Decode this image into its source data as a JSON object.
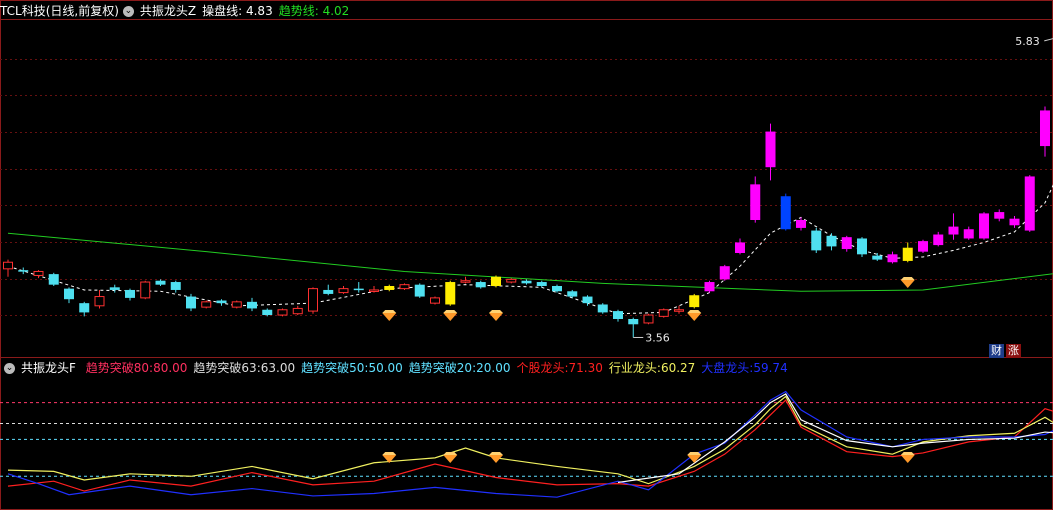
{
  "colors": {
    "up": "#ff00ff",
    "down": "#4fe0f0",
    "signal_bar": "#ffee00",
    "breakout_bar": "#0044ff",
    "ma_line": "#22cc22",
    "trend_line": "#ffffff",
    "diamond": "#ff9a2a",
    "line_red": "#ff2020",
    "line_yellow": "#f0f060",
    "line_blue": "#2030ff",
    "line_white": "#ffffff"
  },
  "header_main": {
    "stock": "TCL科技(日线,前复权)",
    "indicator": "共振龙头Z",
    "op_label": "操盘线:",
    "op_value": "4.83",
    "trend_label": "趋势线:",
    "trend_value": "4.02"
  },
  "header_sub": {
    "indicator": "共振龙头F",
    "items": [
      {
        "label": "趋势突破80:",
        "value": "80.00",
        "color": "#ff3060"
      },
      {
        "label": "趋势突破63:",
        "value": "63.00",
        "color": "#dddddd"
      },
      {
        "label": "趋势突破50:",
        "value": "50.00",
        "color": "#60e0ff"
      },
      {
        "label": "趋势突破20:",
        "value": "20.00",
        "color": "#60e0ff"
      },
      {
        "label": "个股龙头:",
        "value": "71.30",
        "color": "#ff2020"
      },
      {
        "label": "行业龙头:",
        "value": "60.27",
        "color": "#f0f060"
      },
      {
        "label": "大盘龙头:",
        "value": "59.74",
        "color": "#2030ff"
      }
    ]
  },
  "tags": {
    "cai": "财",
    "zhang": "涨"
  },
  "chart_data": [
    {
      "type": "candlestick",
      "ylim": [
        3.45,
        5.95
      ],
      "annotations": [
        {
          "text": "5.83",
          "price": 5.83
        },
        {
          "text": "3.56",
          "price": 3.56
        }
      ],
      "candles": [
        {
          "o": 4.08,
          "c": 4.13,
          "h": 4.15,
          "l": 4.02
        },
        {
          "o": 4.07,
          "c": 4.06,
          "h": 4.09,
          "l": 4.04
        },
        {
          "o": 4.03,
          "c": 4.06,
          "h": 4.07,
          "l": 4.01
        },
        {
          "o": 4.04,
          "c": 3.96,
          "h": 4.05,
          "l": 3.95
        },
        {
          "o": 3.93,
          "c": 3.85,
          "h": 3.94,
          "l": 3.82
        },
        {
          "o": 3.82,
          "c": 3.75,
          "h": 3.83,
          "l": 3.72
        },
        {
          "o": 3.8,
          "c": 3.87,
          "h": 3.92,
          "l": 3.78
        },
        {
          "o": 3.94,
          "c": 3.92,
          "h": 3.96,
          "l": 3.9
        },
        {
          "o": 3.92,
          "c": 3.86,
          "h": 3.93,
          "l": 3.84
        },
        {
          "o": 3.86,
          "c": 3.98,
          "h": 3.99,
          "l": 3.85
        },
        {
          "o": 3.99,
          "c": 3.96,
          "h": 4.0,
          "l": 3.95
        },
        {
          "o": 3.98,
          "c": 3.92,
          "h": 3.99,
          "l": 3.9
        },
        {
          "o": 3.87,
          "c": 3.78,
          "h": 3.89,
          "l": 3.76
        },
        {
          "o": 3.79,
          "c": 3.83,
          "h": 3.84,
          "l": 3.78
        },
        {
          "o": 3.84,
          "c": 3.82,
          "h": 3.85,
          "l": 3.8
        },
        {
          "o": 3.79,
          "c": 3.83,
          "h": 3.84,
          "l": 3.78
        },
        {
          "o": 3.83,
          "c": 3.78,
          "h": 3.86,
          "l": 3.76
        },
        {
          "o": 3.77,
          "c": 3.73,
          "h": 3.78,
          "l": 3.72
        },
        {
          "o": 3.73,
          "c": 3.77,
          "h": 3.78,
          "l": 3.72
        },
        {
          "o": 3.74,
          "c": 3.78,
          "h": 3.8,
          "l": 3.73
        },
        {
          "o": 3.76,
          "c": 3.93,
          "h": 3.94,
          "l": 3.74
        },
        {
          "o": 3.92,
          "c": 3.89,
          "h": 3.96,
          "l": 3.88
        },
        {
          "o": 3.9,
          "c": 3.93,
          "h": 3.95,
          "l": 3.89
        },
        {
          "o": 3.93,
          "c": 3.92,
          "h": 3.98,
          "l": 3.9
        },
        {
          "o": 3.92,
          "c": 3.92,
          "h": 3.95,
          "l": 3.9
        },
        {
          "o": 3.92,
          "c": 3.95,
          "h": 3.96,
          "l": 3.91,
          "s": true
        },
        {
          "o": 3.93,
          "c": 3.96,
          "h": 3.97,
          "l": 3.92
        },
        {
          "o": 3.96,
          "c": 3.87,
          "h": 3.97,
          "l": 3.86
        },
        {
          "o": 3.82,
          "c": 3.86,
          "h": 3.87,
          "l": 3.81
        },
        {
          "o": 3.81,
          "c": 3.98,
          "h": 3.99,
          "l": 3.8,
          "s": true
        },
        {
          "o": 3.98,
          "c": 3.99,
          "h": 4.02,
          "l": 3.97
        },
        {
          "o": 3.98,
          "c": 3.94,
          "h": 3.99,
          "l": 3.93
        },
        {
          "o": 3.95,
          "c": 4.02,
          "h": 4.03,
          "l": 3.94,
          "s": true
        },
        {
          "o": 3.98,
          "c": 4.0,
          "h": 4.01,
          "l": 3.97
        },
        {
          "o": 3.99,
          "c": 3.97,
          "h": 4.0,
          "l": 3.96
        },
        {
          "o": 3.98,
          "c": 3.95,
          "h": 3.99,
          "l": 3.94
        },
        {
          "o": 3.95,
          "c": 3.91,
          "h": 3.96,
          "l": 3.9
        },
        {
          "o": 3.91,
          "c": 3.87,
          "h": 3.92,
          "l": 3.86
        },
        {
          "o": 3.87,
          "c": 3.82,
          "h": 3.88,
          "l": 3.8
        },
        {
          "o": 3.81,
          "c": 3.75,
          "h": 3.82,
          "l": 3.74
        },
        {
          "o": 3.76,
          "c": 3.7,
          "h": 3.77,
          "l": 3.68
        },
        {
          "o": 3.7,
          "c": 3.66,
          "h": 3.71,
          "l": 3.56
        },
        {
          "o": 3.67,
          "c": 3.73,
          "h": 3.74,
          "l": 3.66
        },
        {
          "o": 3.72,
          "c": 3.77,
          "h": 3.78,
          "l": 3.71
        },
        {
          "o": 3.77,
          "c": 3.77,
          "h": 3.8,
          "l": 3.74
        },
        {
          "o": 3.79,
          "c": 3.88,
          "h": 3.89,
          "l": 3.78,
          "s": true
        },
        {
          "o": 3.91,
          "c": 3.98,
          "h": 3.99,
          "l": 3.9
        },
        {
          "o": 4.0,
          "c": 4.1,
          "h": 4.11,
          "l": 3.99
        },
        {
          "o": 4.2,
          "c": 4.28,
          "h": 4.31,
          "l": 4.19
        },
        {
          "o": 4.45,
          "c": 4.72,
          "h": 4.78,
          "l": 4.43
        },
        {
          "o": 4.85,
          "c": 5.12,
          "h": 5.18,
          "l": 4.75
        },
        {
          "o": 4.63,
          "c": 4.38,
          "h": 4.65,
          "l": 4.37,
          "b": true
        },
        {
          "o": 4.39,
          "c": 4.45,
          "h": 4.47,
          "l": 4.37
        },
        {
          "o": 4.37,
          "c": 4.22,
          "h": 4.39,
          "l": 4.2
        },
        {
          "o": 4.33,
          "c": 4.25,
          "h": 4.35,
          "l": 4.22
        },
        {
          "o": 4.23,
          "c": 4.32,
          "h": 4.33,
          "l": 4.21
        },
        {
          "o": 4.31,
          "c": 4.19,
          "h": 4.32,
          "l": 4.17
        },
        {
          "o": 4.18,
          "c": 4.15,
          "h": 4.2,
          "l": 4.14
        },
        {
          "o": 4.13,
          "c": 4.19,
          "h": 4.21,
          "l": 4.12
        },
        {
          "o": 4.14,
          "c": 4.24,
          "h": 4.28,
          "l": 4.13,
          "s": true
        },
        {
          "o": 4.21,
          "c": 4.29,
          "h": 4.3,
          "l": 4.2
        },
        {
          "o": 4.26,
          "c": 4.34,
          "h": 4.36,
          "l": 4.25
        },
        {
          "o": 4.34,
          "c": 4.4,
          "h": 4.5,
          "l": 4.3
        },
        {
          "o": 4.31,
          "c": 4.38,
          "h": 4.4,
          "l": 4.3
        },
        {
          "o": 4.31,
          "c": 4.5,
          "h": 4.51,
          "l": 4.3
        },
        {
          "o": 4.46,
          "c": 4.51,
          "h": 4.53,
          "l": 4.44
        },
        {
          "o": 4.41,
          "c": 4.46,
          "h": 4.48,
          "l": 4.39
        },
        {
          "o": 4.37,
          "c": 4.78,
          "h": 4.79,
          "l": 4.36
        },
        {
          "o": 5.01,
          "c": 5.28,
          "h": 5.31,
          "l": 4.93
        },
        {
          "o": 5.35,
          "c": 5.83,
          "h": 5.84,
          "l": 5.19
        }
      ],
      "ma_line": {
        "x": [
          0,
          13,
          26,
          39,
          52,
          60,
          69
        ],
        "y": [
          4.35,
          4.21,
          4.06,
          3.97,
          3.91,
          3.92,
          4.05
        ]
      },
      "op_line": {
        "x": [
          0,
          5,
          10,
          15,
          20,
          25,
          30,
          35,
          40,
          43,
          46,
          48,
          50,
          52,
          54,
          56,
          58,
          60,
          62,
          64,
          66,
          68,
          69
        ],
        "y": [
          4.1,
          3.92,
          3.91,
          3.8,
          3.82,
          3.93,
          3.96,
          3.94,
          3.74,
          3.75,
          3.9,
          4.1,
          4.35,
          4.47,
          4.33,
          4.22,
          4.16,
          4.17,
          4.22,
          4.28,
          4.36,
          4.58,
          4.83
        ]
      },
      "diamonds": [
        25,
        29,
        32,
        45,
        59
      ]
    },
    {
      "type": "line",
      "ylim": [
        -5,
        100
      ],
      "reference_lines": [
        80,
        63,
        50,
        20
      ],
      "series": [
        {
          "name": "个股龙头",
          "x": [
            0,
            3,
            5,
            8,
            12,
            16,
            20,
            24,
            28,
            32,
            36,
            40,
            42,
            45,
            47,
            49,
            50,
            51,
            52,
            55,
            58,
            60,
            63,
            66,
            68,
            69
          ],
          "y": [
            12,
            16,
            8,
            17,
            12,
            23,
            13,
            16,
            30,
            19,
            13,
            14,
            12,
            24,
            38,
            58,
            70,
            82,
            60,
            40,
            36,
            39,
            48,
            52,
            75,
            71.3
          ]
        },
        {
          "name": "行业龙头",
          "x": [
            0,
            3,
            5,
            8,
            12,
            16,
            20,
            24,
            28,
            30,
            32,
            36,
            40,
            42,
            45,
            47,
            49,
            50,
            51,
            52,
            55,
            58,
            60,
            63,
            66,
            68,
            69
          ],
          "y": [
            25,
            24,
            17,
            22,
            20,
            28,
            18,
            31,
            35,
            43,
            35,
            28,
            22,
            14,
            28,
            42,
            62,
            75,
            85,
            62,
            44,
            38,
            48,
            53,
            55,
            68,
            60.27
          ]
        },
        {
          "name": "大盘龙头",
          "x": [
            0,
            2,
            4,
            8,
            12,
            16,
            20,
            24,
            28,
            32,
            36,
            40,
            42,
            45,
            47,
            49,
            50,
            51,
            52,
            55,
            58,
            60,
            63,
            66,
            68,
            69
          ],
          "y": [
            22,
            14,
            5,
            12,
            5,
            10,
            4,
            6,
            11,
            6,
            3,
            16,
            9,
            38,
            47,
            70,
            82,
            89,
            74,
            52,
            44,
            50,
            52,
            52,
            54,
            59.74
          ]
        },
        {
          "name": "",
          "x": [
            40,
            44,
            47,
            49,
            50,
            51,
            52,
            55,
            58,
            60,
            63,
            66,
            68,
            69
          ],
          "y": [
            15,
            22,
            48,
            68,
            80,
            87,
            66,
            49,
            44,
            47,
            50,
            51,
            56,
            55
          ]
        }
      ],
      "diamonds": [
        25,
        29,
        32,
        45,
        59
      ]
    }
  ]
}
